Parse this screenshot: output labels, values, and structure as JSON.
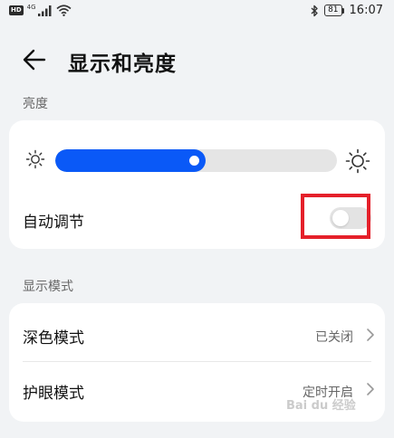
{
  "status_bar": {
    "hd_badge": "HD",
    "network_type": "4G",
    "battery": "81",
    "time": "16:07",
    "icons": [
      "signal-icon",
      "wifi-icon",
      "bluetooth-icon",
      "battery-icon"
    ]
  },
  "header": {
    "back_icon": "arrow-left-icon",
    "title": "显示和亮度"
  },
  "brightness": {
    "section_label": "亮度",
    "level": 0.5,
    "auto_adjust_label": "自动调节",
    "auto_adjust_on": false,
    "highlight_color": "#e5202a"
  },
  "display_mode": {
    "section_label": "显示模式",
    "items": [
      {
        "label": "深色模式",
        "value": "已关闭"
      },
      {
        "label": "护眼模式",
        "value": "定时开启"
      }
    ]
  },
  "colors": {
    "accent": "#0a59f7",
    "background": "#f1f3f5",
    "card": "#ffffff"
  },
  "watermark": "Bai du 经验"
}
